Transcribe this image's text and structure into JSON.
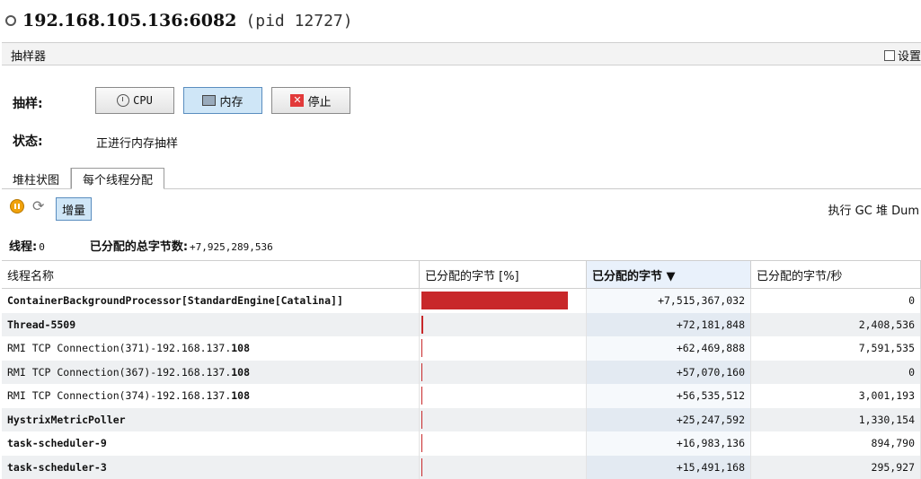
{
  "title": {
    "host": "192.168.105.136:6082",
    "pid": "(pid 12727)"
  },
  "sampler": {
    "label": "抽样器",
    "settings_label": "设置"
  },
  "sample": {
    "label": "抽样:",
    "cpu_label": "CPU",
    "memory_label": "内存",
    "stop_label": "停止"
  },
  "status": {
    "label": "状态:",
    "value": "正进行内存抽样"
  },
  "tabs": [
    {
      "label": "堆柱状图"
    },
    {
      "label": "每个线程分配"
    }
  ],
  "toolbar": {
    "delta_label": "增量",
    "right_text": "执行 GC  堆 Dum"
  },
  "stats": {
    "threads_label": "线程:",
    "threads_value": "0",
    "total_label": "已分配的总字节数:",
    "total_value": "+7,925,289,536"
  },
  "table": {
    "columns": [
      "线程名称",
      "已分配的字节 [%]",
      "已分配的字节 ▼",
      "已分配的字节/秒"
    ],
    "accent": "#c8282a",
    "rows": [
      {
        "pre": "",
        "name": "ContainerBackgroundProcessor[StandardEngine[Catalina]]",
        "percent": 94.8,
        "bytes": "+7,515,367,032",
        "rate": "0"
      },
      {
        "pre": "",
        "name": "Thread-5509",
        "percent": 0.91,
        "bytes": "+72,181,848",
        "rate": "2,408,536"
      },
      {
        "pre": "RMI TCP Connection(371)-192.168.137.",
        "name": "108",
        "percent": 0.79,
        "bytes": "+62,469,888",
        "rate": "7,591,535"
      },
      {
        "pre": "RMI TCP Connection(367)-192.168.137.",
        "name": "108",
        "percent": 0.72,
        "bytes": "+57,070,160",
        "rate": "0"
      },
      {
        "pre": "RMI TCP Connection(374)-192.168.137.",
        "name": "108",
        "percent": 0.71,
        "bytes": "+56,535,512",
        "rate": "3,001,193"
      },
      {
        "pre": "",
        "name": "HystrixMetricPoller",
        "percent": 0.32,
        "bytes": "+25,247,592",
        "rate": "1,330,154"
      },
      {
        "pre": "",
        "name": "task-scheduler-9",
        "percent": 0.21,
        "bytes": "+16,983,136",
        "rate": "894,790"
      },
      {
        "pre": "",
        "name": "task-scheduler-3",
        "percent": 0.2,
        "bytes": "+15,491,168",
        "rate": "295,927"
      }
    ]
  }
}
